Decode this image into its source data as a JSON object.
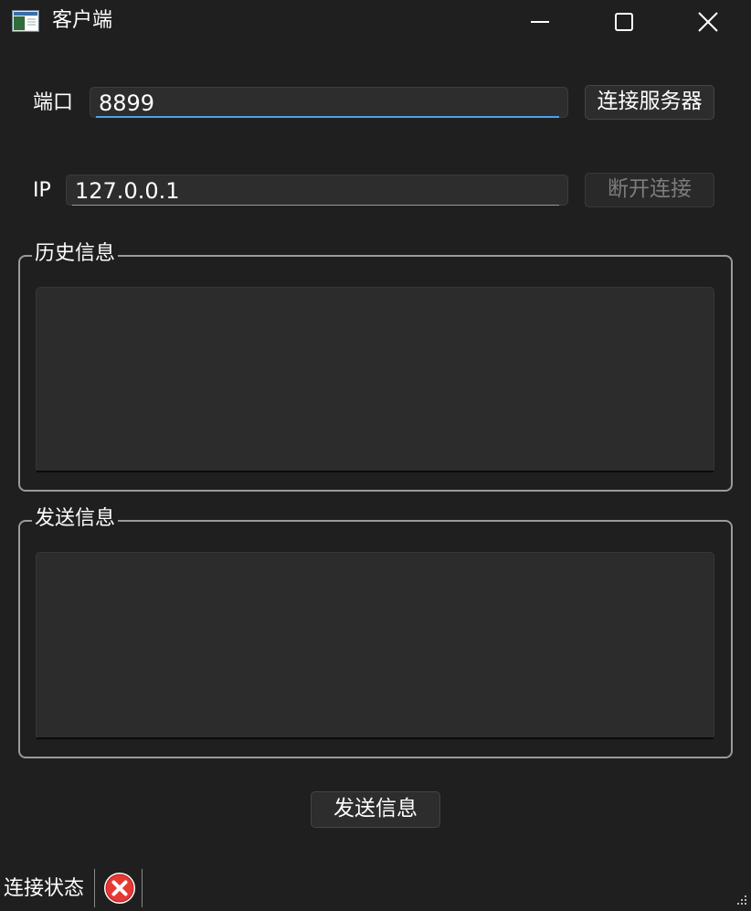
{
  "window": {
    "title": "客户端",
    "app_icon": "app-window-icon",
    "controls": {
      "minimize": "minimize-icon",
      "maximize": "maximize-icon",
      "close": "close-icon"
    }
  },
  "connection": {
    "port_label": "端口",
    "port_value": "8899",
    "ip_label": "IP",
    "ip_value": "127.0.0.1",
    "connect_button": "连接服务器",
    "disconnect_button": "断开连接"
  },
  "history": {
    "title": "历史信息",
    "content": ""
  },
  "send": {
    "title": "发送信息",
    "content": "",
    "send_button": "发送信息"
  },
  "statusbar": {
    "label": "连接状态",
    "status_icon": "disconnected-error-icon"
  },
  "colors": {
    "background": "#1f1f1f",
    "input_background": "#2d2d2d",
    "focus_accent": "#4aa3f0",
    "error_red": "#e53935"
  }
}
